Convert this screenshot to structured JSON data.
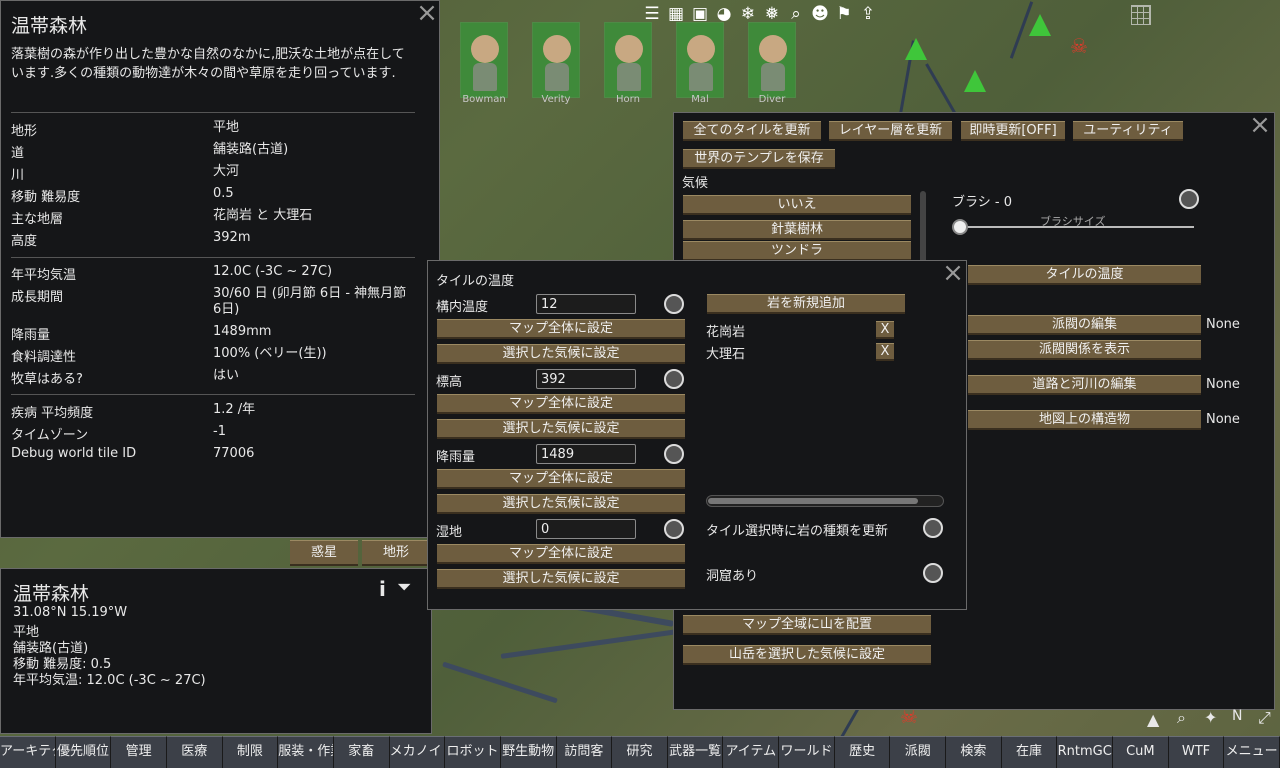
{
  "tile_info": {
    "title": "温帯森林",
    "description": "落葉樹の森が作り出した豊かな自然のなかに,肥沃な土地が点在しています.多くの種類の動物達が木々の間や草原を走り回っています.",
    "rows1": [
      {
        "label": "地形",
        "value": "平地"
      },
      {
        "label": "道",
        "value": "舗装路(古道)"
      },
      {
        "label": "川",
        "value": "大河"
      },
      {
        "label": "移動 難易度",
        "value": "0.5"
      },
      {
        "label": "主な地層",
        "value": "花崗岩 と 大理石"
      },
      {
        "label": "高度",
        "value": "392m"
      }
    ],
    "rows2": [
      {
        "label": "年平均気温",
        "value": "12.0C (-3C ~ 27C)"
      },
      {
        "label": "成長期間",
        "value": "30/60 日 (卯月節 6日 - 神無月節 6日)"
      },
      {
        "label": "降雨量",
        "value": "1489mm"
      },
      {
        "label": "食料調達性",
        "value": "100% (ベリー(生))"
      },
      {
        "label": "牧草はある?",
        "value": "はい"
      }
    ],
    "rows3": [
      {
        "label": "疾病 平均頻度",
        "value": "1.2 /年"
      },
      {
        "label": "タイムゾーン",
        "value": "-1"
      },
      {
        "label": "Debug world tile ID",
        "value": "77006"
      }
    ],
    "tab_planet": "惑星",
    "tab_terrain": "地形"
  },
  "mini_info": {
    "title": "温帯森林",
    "coords": "31.08°N 15.19°W",
    "line1": "平地",
    "line2": "舗装路(古道)",
    "line3": "移動 難易度: 0.5",
    "line4": "年平均気温: 12.0C (-3C ~ 27C)"
  },
  "colonists": [
    "Bowman",
    "Verity",
    "Horn",
    "Mal",
    "Diver"
  ],
  "editor": {
    "btn_update_all": "全てのタイルを更新",
    "btn_update_layers": "レイヤー層を更新",
    "btn_instant": "即時更新[OFF]",
    "btn_utility": "ユーティリティ",
    "btn_save_template": "世界のテンプレを保存",
    "climate_label": "気候",
    "climate_options": [
      "いいえ",
      "針葉樹林",
      "ツンドラ"
    ],
    "brush_label": "ブラシ - 0",
    "brush_size_label": "ブラシサイズ",
    "btn_tile_temp": "タイルの温度",
    "btn_faction_edit": "派閥の編集",
    "faction_value": "None",
    "btn_show_relations": "派閥関係を表示",
    "btn_road_river": "道路と河川の編集",
    "road_value": "None",
    "btn_structures": "地図上の構造物",
    "structures_value": "None",
    "btn_place_mountains": "マップ全域に山を配置",
    "btn_mountains_climate": "山岳を選択した気候に設定"
  },
  "temp_dialog": {
    "title": "タイルの温度",
    "fields": [
      {
        "label": "構内温度",
        "value": "12"
      },
      {
        "label": "標高",
        "value": "392"
      },
      {
        "label": "降雨量",
        "value": "1489"
      },
      {
        "label": "湿地",
        "value": "0"
      }
    ],
    "btn_set_map": "マップ全体に設定",
    "btn_set_climate": "選択した気候に設定",
    "btn_add_rock": "岩を新規追加",
    "rocks": [
      "花崗岩",
      "大理石"
    ],
    "remove_label": "X",
    "update_rock_label": "タイル選択時に岩の種類を更新",
    "caves_label": "洞窟あり"
  },
  "bottom_tabs": [
    "アーキテクト",
    "優先順位",
    "管理",
    "医療",
    "制限",
    "服装・作業",
    "家畜",
    "メカノイド",
    "ロボット",
    "野生動物",
    "訪問客",
    "研究",
    "武器一覧",
    "アイテム",
    "ワールド",
    "歴史",
    "派閥",
    "検索",
    "在庫",
    "RntmGC",
    "CuM",
    "WTF",
    "メニュー"
  ],
  "colors": {
    "button": "#6e5d3f",
    "panel": "#151618",
    "colonist_bg": "#3f8a3a"
  }
}
